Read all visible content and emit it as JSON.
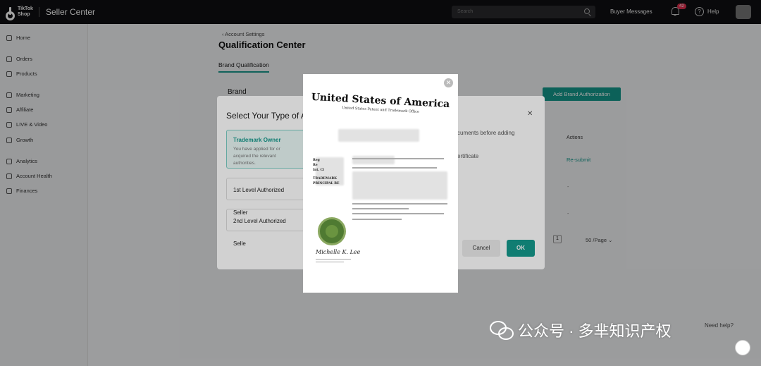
{
  "topbar": {
    "logo_text": "TikTok Shop",
    "app_title": "Seller Center",
    "search_placeholder": "Search",
    "buyer_messages": "Buyer Messages",
    "notification_count": "42",
    "help": "Help"
  },
  "sidebar": {
    "items": [
      {
        "label": "Home"
      },
      {
        "label": "Orders"
      },
      {
        "label": "Products"
      },
      {
        "label": "Marketing"
      },
      {
        "label": "Affiliate"
      },
      {
        "label": "LIVE & Video"
      },
      {
        "label": "Growth"
      },
      {
        "label": "Analytics"
      },
      {
        "label": "Account Health"
      },
      {
        "label": "Finances"
      }
    ]
  },
  "main": {
    "breadcrumb": "Account Settings",
    "title": "Qualification Center",
    "tab": "Brand Qualification",
    "section_title": "Brand",
    "add_button": "Add Brand Authorization",
    "table_actions_header": "Actions",
    "resubmit": "Re-submit",
    "dash": "-",
    "page_number": "1",
    "per_page": "50 /Page"
  },
  "modal": {
    "title": "Select Your Type of A",
    "option_trademark_title": "Trademark Owner",
    "option_trademark_desc": "You have applied for or acquired the relevant authorities.",
    "option_first_level": "1st Level Authorized Seller",
    "option_second_level": "2nd Level Authorized Selle",
    "note_documents": "cuments before adding",
    "note_certificate": "ertificate",
    "cancel": "Cancel",
    "ok": "OK"
  },
  "certificate": {
    "title": "United States of America",
    "subtitle": "United States Patent and Trademark Office",
    "label_reg": "Reg",
    "label_re": "Re",
    "label_int": "Int. Cl",
    "label_trademark": "TRADEMARK",
    "label_principal": "PRINCIPAL RE"
  },
  "watermark": {
    "text": "公众号 · 多芈知识产权"
  },
  "need_help": "Need help?",
  "colors": {
    "accent": "#14998c",
    "topbar": "#0f0f12"
  }
}
